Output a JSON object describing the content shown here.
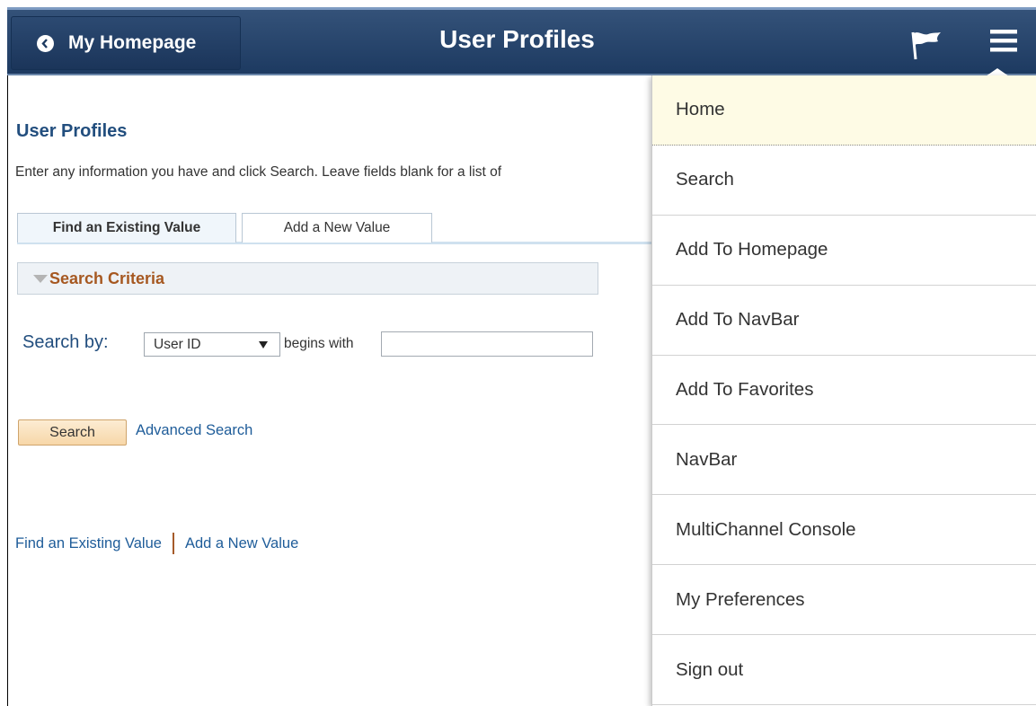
{
  "header": {
    "back_label": "My Homepage",
    "title": "User Profiles",
    "icons": [
      "chevron-left-icon",
      "flag-icon",
      "hamburger-menu-icon"
    ],
    "colors": {
      "bar": "#1d3a61",
      "text": "#ffffff"
    }
  },
  "main": {
    "heading": "User Profiles",
    "instructions": "Enter any information you have and click Search. Leave fields blank for a list of",
    "tabs": [
      {
        "label": "Find an Existing Value",
        "active": true
      },
      {
        "label": "Add a New Value",
        "active": false
      }
    ],
    "criteria_label": "Search Criteria",
    "search_by_label": "Search by:",
    "search_by_value": "User ID",
    "operator_label": "begins with",
    "search_input_value": "",
    "search_button_label": "Search",
    "advanced_search_label": "Advanced Search",
    "bottom_links": [
      "Find an Existing Value",
      "Add a New Value"
    ]
  },
  "menu": {
    "items": [
      {
        "label": "Home",
        "active": true
      },
      {
        "label": "Search"
      },
      {
        "label": "Add To Homepage"
      },
      {
        "label": "Add To NavBar"
      },
      {
        "label": "Add To Favorites"
      },
      {
        "label": "NavBar"
      },
      {
        "label": "MultiChannel Console"
      },
      {
        "label": "My Preferences"
      },
      {
        "label": "Sign out"
      }
    ]
  }
}
